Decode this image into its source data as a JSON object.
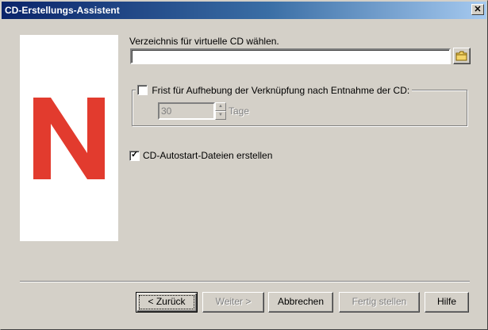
{
  "window": {
    "title": "CD-Erstellungs-Assistent",
    "close_label": "✕"
  },
  "directory": {
    "label": "Verzeichnis für virtuelle CD wählen.",
    "value": ""
  },
  "expiry": {
    "checkbox_label": "Frist für Aufhebung der Verknüpfung nach Entnahme der CD:",
    "checked": false,
    "days_value": "30",
    "days_unit": "Tage"
  },
  "autostart": {
    "label": "CD-Autostart-Dateien erstellen",
    "checked": true,
    "check_glyph": "✓"
  },
  "buttons": {
    "back": "< Zurück",
    "next": "Weiter >",
    "cancel": "Abbrechen",
    "finish": "Fertig stellen",
    "help": "Hilfe"
  },
  "colors": {
    "logo_red": "#e23b2e",
    "title_start": "#0a246a",
    "title_end": "#a6caf0"
  },
  "icons": {
    "browse": "folder-icon",
    "logo": "novell-n-logo",
    "close": "close-icon",
    "spin_up": "arrow-up-icon",
    "spin_down": "arrow-down-icon"
  }
}
